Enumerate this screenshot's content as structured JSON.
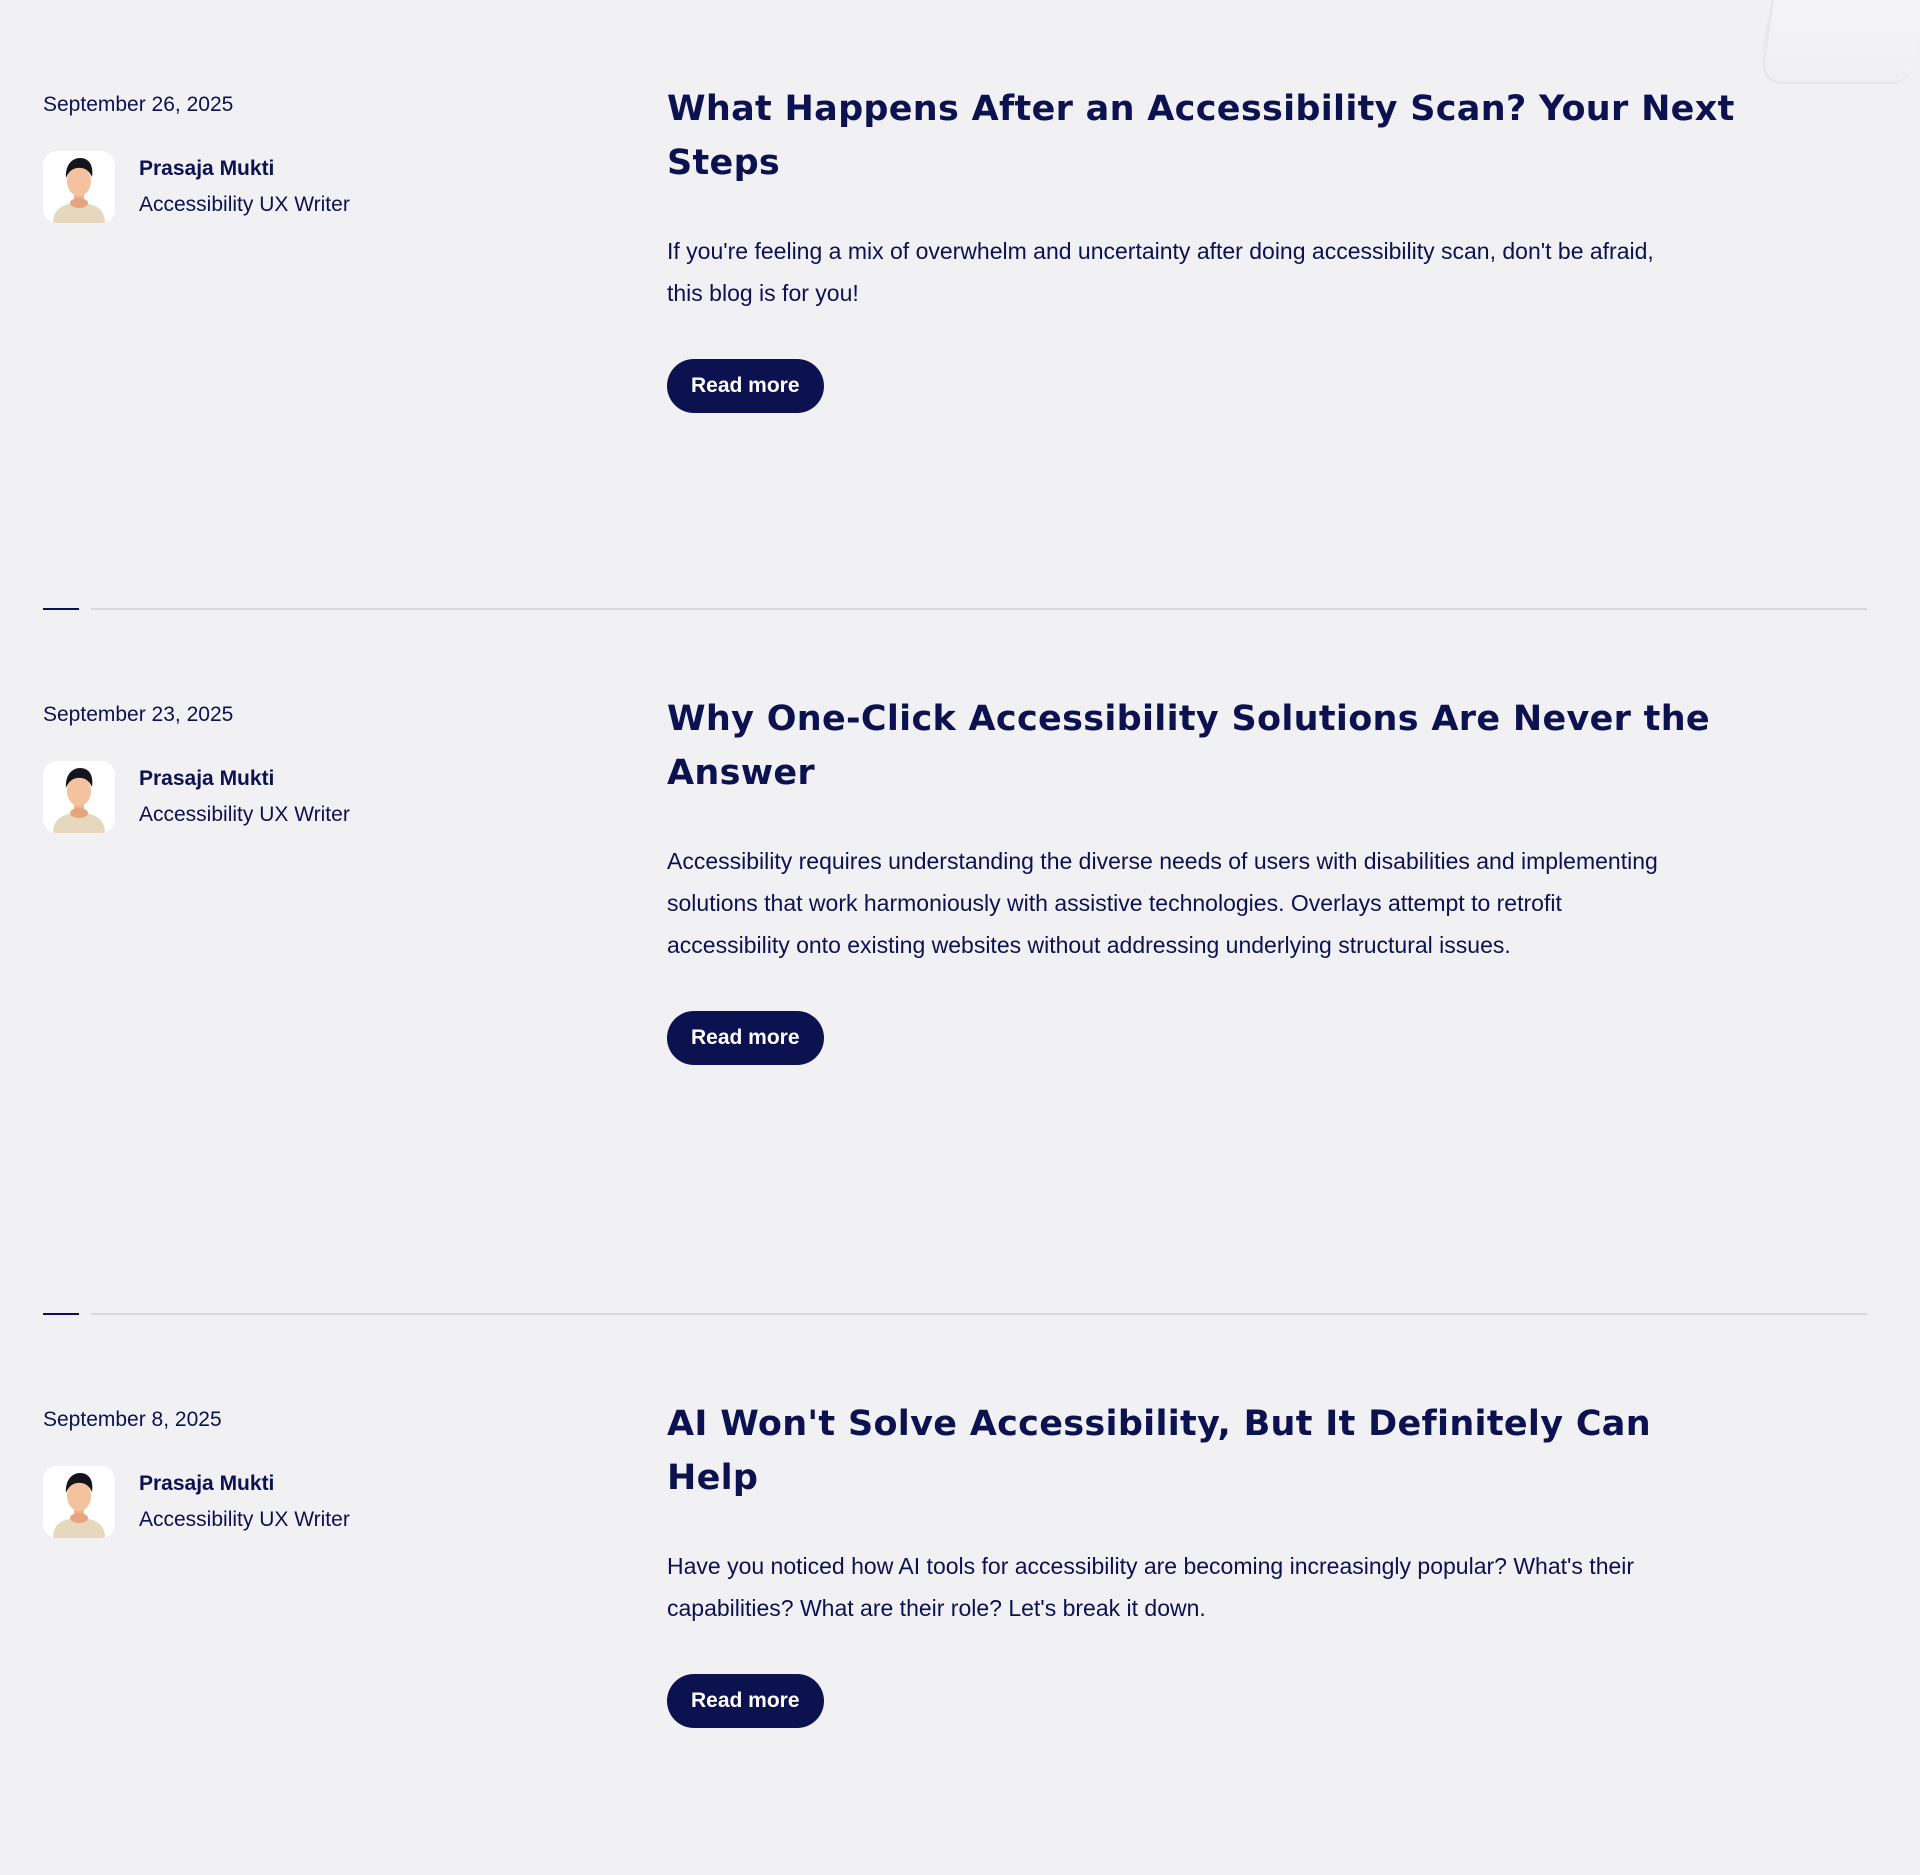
{
  "posts": [
    {
      "date": "September 26, 2025",
      "author": {
        "name": "Prasaja Mukti",
        "role": "Accessibility UX Writer"
      },
      "title": "What Happens After an Accessibility Scan? Your Next Steps",
      "excerpt": "If you're feeling a mix of overwhelm and uncertainty after doing accessibility scan, don't be afraid, this blog is for you!",
      "button_label": "Read more"
    },
    {
      "date": "September 23, 2025",
      "author": {
        "name": "Prasaja Mukti",
        "role": "Accessibility UX Writer"
      },
      "title": "Why One-Click Accessibility Solutions Are Never the Answer",
      "excerpt": "Accessibility requires understanding the diverse needs of users with disabilities and implementing solutions that work harmoniously with assistive technologies. Overlays attempt to retrofit accessibility onto existing websites without addressing underlying structural issues.",
      "button_label": "Read more"
    },
    {
      "date": "September 8, 2025",
      "author": {
        "name": "Prasaja Mukti",
        "role": "Accessibility UX Writer"
      },
      "title": "AI Won't Solve Accessibility, But It Definitely Can Help",
      "excerpt": "Have you noticed how AI tools for accessibility are becoming increasingly popular? What's their capabilities? What are their role? Let's break it down.",
      "button_label": "Read more"
    }
  ],
  "colors": {
    "background": "#f1f1f4",
    "text": "#0c1150",
    "button_bg": "#0c1150",
    "button_text": "#ffffff",
    "divider": "#d7d7dc"
  },
  "icons": {
    "avatar": "person-avatar-icon"
  }
}
